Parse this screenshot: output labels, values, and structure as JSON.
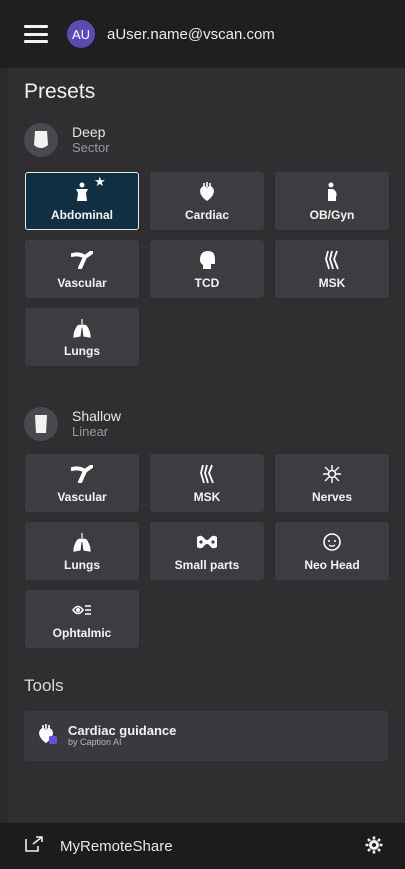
{
  "header": {
    "avatar_initials": "AU",
    "user_email": "aUser.name@vscan.com",
    "menu_icon": "hamburger-icon"
  },
  "presets": {
    "title": "Presets",
    "probes": [
      {
        "name": "Deep",
        "type": "Sector",
        "icon": "sector-probe-icon",
        "tiles": [
          {
            "label": "Abdominal",
            "icon": "abdominal-icon",
            "selected": true,
            "favorite": true
          },
          {
            "label": "Cardiac",
            "icon": "heart-icon"
          },
          {
            "label": "OB/Gyn",
            "icon": "pregnancy-icon"
          },
          {
            "label": "Vascular",
            "icon": "vessel-icon"
          },
          {
            "label": "TCD",
            "icon": "head-icon"
          },
          {
            "label": "MSK",
            "icon": "knee-icon"
          },
          {
            "label": "Lungs",
            "icon": "lungs-icon"
          }
        ]
      },
      {
        "name": "Shallow",
        "type": "Linear",
        "icon": "linear-probe-icon",
        "tiles": [
          {
            "label": "Vascular",
            "icon": "vessel-icon"
          },
          {
            "label": "MSK",
            "icon": "knee-icon"
          },
          {
            "label": "Nerves",
            "icon": "nerve-icon"
          },
          {
            "label": "Lungs",
            "icon": "lungs-icon"
          },
          {
            "label": "Small parts",
            "icon": "small-parts-icon"
          },
          {
            "label": "Neo Head",
            "icon": "baby-head-icon"
          },
          {
            "label": "Ophtalmic",
            "icon": "eye-icon"
          }
        ]
      }
    ]
  },
  "tools": {
    "title": "Tools",
    "items": [
      {
        "name": "Cardiac guidance",
        "subtitle": "by Caption AI",
        "icon": "cardiac-guidance-icon"
      }
    ]
  },
  "footer": {
    "share_label": "MyRemoteShare",
    "share_icon": "external-link-icon",
    "settings_icon": "gear-icon"
  },
  "colors": {
    "background": "#2b2b2e",
    "tile": "#3d3d41",
    "selected_tile": "#102f43",
    "avatar": "#5a4bb3"
  }
}
